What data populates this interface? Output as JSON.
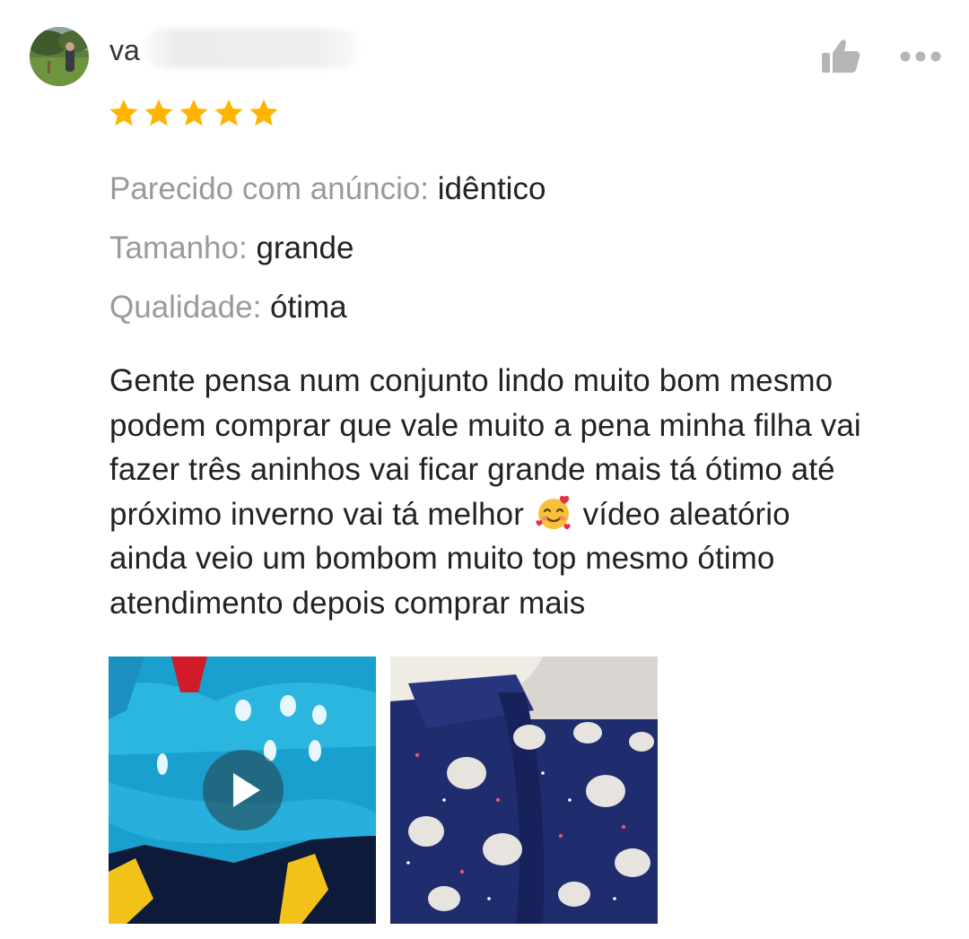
{
  "review": {
    "username_visible": "va",
    "rating": 5,
    "rating_max": 5,
    "attributes": [
      {
        "label": "Parecido com anúncio:",
        "value": "idêntico"
      },
      {
        "label": "Tamanho:",
        "value": "grande"
      },
      {
        "label": "Qualidade:",
        "value": "ótima"
      }
    ],
    "text_lines": [
      "Gente pensa num conjunto lindo muito bom mesmo",
      "podem comprar que vale muito a pena minha filha vai",
      "fazer três aninhos vai ficar grande mais tá ótimo até",
      "próximo inverno vai tá melhor",
      "vídeo aleatório",
      "ainda veio um bombom muito top mesmo ótimo",
      "atendimento depois comprar mais"
    ],
    "emoji": "smiling-face-with-hearts-icon",
    "media": [
      {
        "type": "video",
        "icon": "play-icon"
      },
      {
        "type": "image"
      }
    ]
  },
  "icons": {
    "like": "thumbs-up-icon",
    "more": "more-dots-icon"
  },
  "colors": {
    "star": "#FFB400",
    "label_gray": "#9A9A9A",
    "text_dark": "#222222",
    "icon_gray": "#B5B5B5"
  }
}
